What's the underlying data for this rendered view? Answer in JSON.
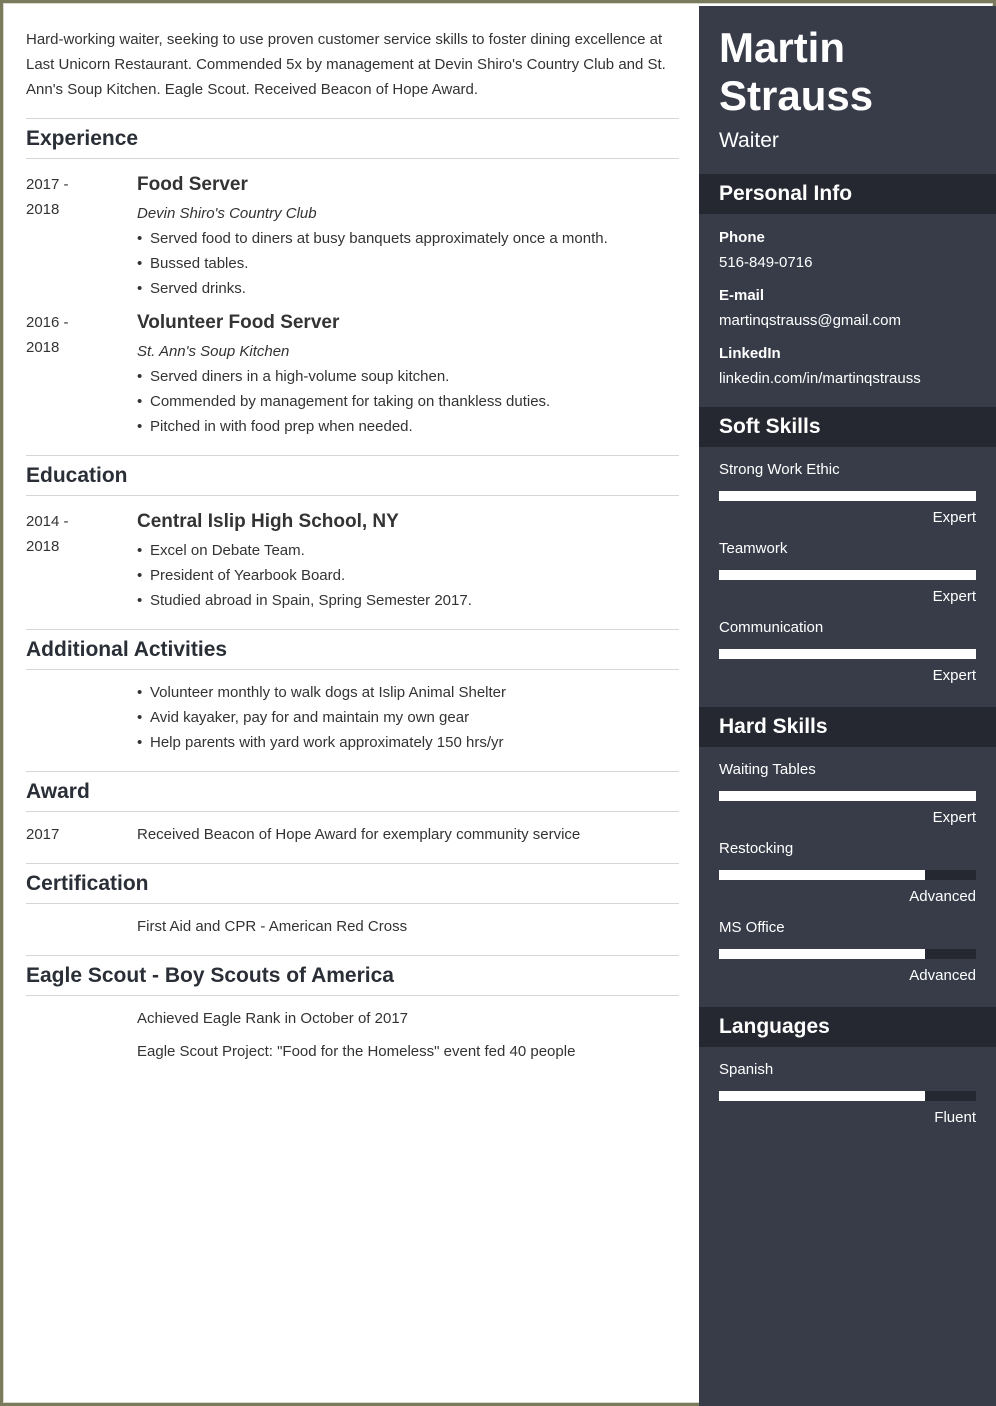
{
  "header": {
    "name_line1": "Martin",
    "name_line2": "Strauss",
    "role": "Waiter"
  },
  "summary": "Hard-working waiter, seeking to use proven customer service skills to foster dining excellence at Last Unicorn Restaurant. Commended 5x by management at Devin Shiro's Country Club and St. Ann's Soup Kitchen. Eagle Scout. Received Beacon of Hope Award.",
  "experience": {
    "heading": "Experience",
    "entries": [
      {
        "date_start": "2017 -",
        "date_end": "2018",
        "title": "Food Server",
        "org": "Devin Shiro's Country Club",
        "bullets": [
          "Served food to diners at busy banquets approximately once a month.",
          "Bussed tables.",
          "Served drinks."
        ]
      },
      {
        "date_start": "2016 -",
        "date_end": "2018",
        "title": "Volunteer Food Server",
        "org": "St. Ann's Soup Kitchen",
        "bullets": [
          "Served diners in a high-volume soup kitchen.",
          "Commended by management for taking on thankless duties.",
          "Pitched in with food prep when needed."
        ]
      }
    ]
  },
  "education": {
    "heading": "Education",
    "entries": [
      {
        "date_start": "2014 -",
        "date_end": "2018",
        "title": "Central Islip High School, NY",
        "bullets": [
          "Excel on Debate Team.",
          "President of Yearbook Board.",
          "Studied abroad in Spain, Spring Semester 2017."
        ]
      }
    ]
  },
  "activities": {
    "heading": "Additional Activities",
    "bullets": [
      "Volunteer monthly to walk dogs at Islip Animal Shelter",
      "Avid kayaker, pay for and maintain my own gear",
      "Help parents with yard work approximately 150 hrs/yr"
    ]
  },
  "award": {
    "heading": "Award",
    "date": "2017",
    "text": "Received Beacon of Hope Award for exemplary community service"
  },
  "certification": {
    "heading": "Certification",
    "text": "First Aid and CPR - American Red Cross"
  },
  "eagle_scout": {
    "heading": "Eagle Scout - Boy Scouts of America",
    "lines": [
      "Achieved Eagle Rank in October of 2017",
      "Eagle Scout Project: \"Food for the Homeless\" event fed 40 people"
    ]
  },
  "personal_info": {
    "heading": "Personal Info",
    "phone_label": "Phone",
    "phone": "516-849-0716",
    "email_label": "E-mail",
    "email": "martinqstrauss@gmail.com",
    "linkedin_label": "LinkedIn",
    "linkedin": "linkedin.com/in/martinqstrauss"
  },
  "soft_skills": {
    "heading": "Soft Skills",
    "items": [
      {
        "name": "Strong Work Ethic",
        "level": "Expert",
        "fraction": 1.0
      },
      {
        "name": "Teamwork",
        "level": "Expert",
        "fraction": 1.0
      },
      {
        "name": "Communication",
        "level": "Expert",
        "fraction": 1.0
      }
    ]
  },
  "hard_skills": {
    "heading": "Hard Skills",
    "items": [
      {
        "name": "Waiting Tables",
        "level": "Expert",
        "fraction": 1.0
      },
      {
        "name": "Restocking",
        "level": "Advanced",
        "fraction": 0.8
      },
      {
        "name": "MS Office",
        "level": "Advanced",
        "fraction": 0.8
      }
    ]
  },
  "languages": {
    "heading": "Languages",
    "items": [
      {
        "name": "Spanish",
        "level": "Fluent",
        "fraction": 0.8
      }
    ]
  },
  "colors": {
    "sidebar_bg": "#373c48",
    "sidebar_heading_bg": "#252830",
    "bar_fill": "#ffffff",
    "text": "#333333"
  }
}
